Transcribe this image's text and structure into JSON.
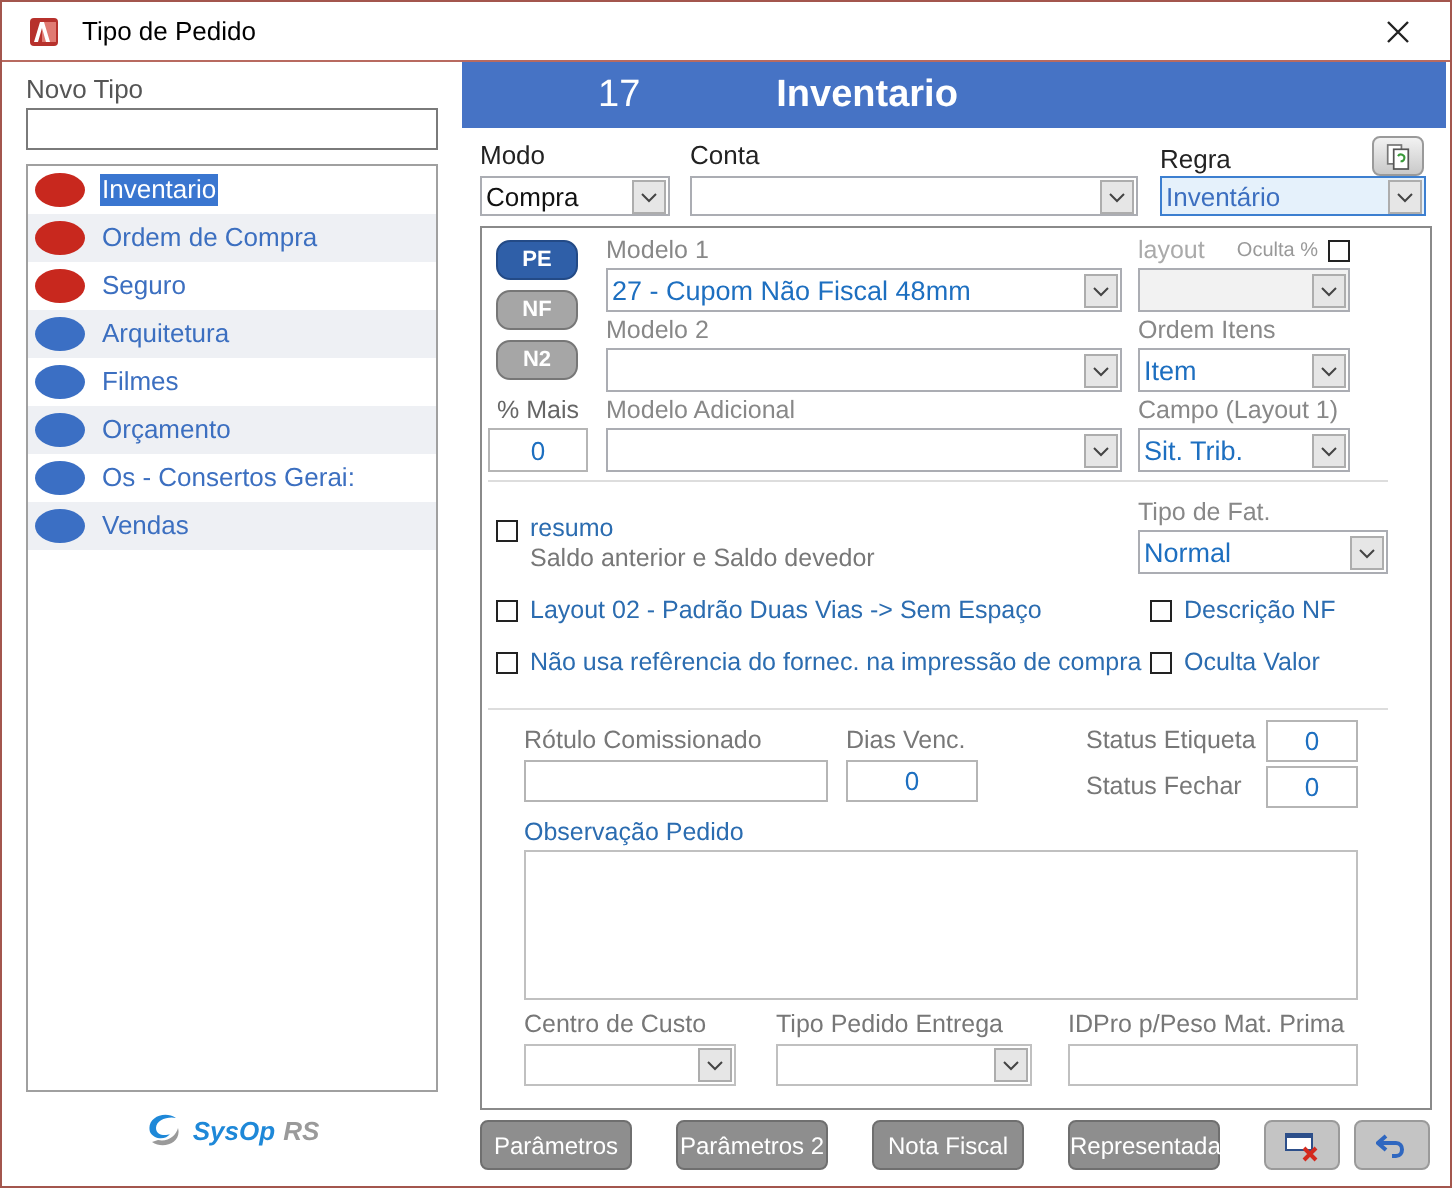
{
  "window": {
    "title": "Tipo de Pedido"
  },
  "new_type": {
    "label": "Novo Tipo"
  },
  "type_list": {
    "items": [
      {
        "name": "Inventario",
        "color": "#c8281e",
        "selected": true
      },
      {
        "name": "Ordem de Compra",
        "color": "#c8281e",
        "selected": false
      },
      {
        "name": "Seguro",
        "color": "#c8281e",
        "selected": false
      },
      {
        "name": "Arquitetura",
        "color": "#3b6fc4",
        "selected": false
      },
      {
        "name": "Filmes",
        "color": "#3b6fc4",
        "selected": false
      },
      {
        "name": "Orçamento",
        "color": "#3b6fc4",
        "selected": false
      },
      {
        "name": "Os - Consertos Gerai:",
        "color": "#3b6fc4",
        "selected": false
      },
      {
        "name": "Vendas",
        "color": "#3b6fc4",
        "selected": false
      }
    ]
  },
  "logo": {
    "name": "SysOp",
    "suffix": "RS"
  },
  "header": {
    "number": "17",
    "name": "Inventario"
  },
  "modo": {
    "label": "Modo",
    "value": "Compra"
  },
  "conta": {
    "label": "Conta"
  },
  "regra": {
    "label": "Regra",
    "value": "Inventário",
    "focused": true
  },
  "print_buttons": [
    {
      "label": "PE",
      "selected": true
    },
    {
      "label": "NF",
      "selected": false
    },
    {
      "label": "N2",
      "selected": false
    }
  ],
  "percent_more": {
    "label": "% Mais",
    "value": "0"
  },
  "modelo_1": {
    "label": "Modelo 1",
    "value": "27 - Cupom Não Fiscal 48mm"
  },
  "modelo_2": {
    "label": "Modelo 2"
  },
  "modelo_adicional": {
    "label": "Modelo Adicional"
  },
  "layout": {
    "label": "layout",
    "disabled": true
  },
  "oculta_percent": {
    "label": "Oculta %",
    "checked": false
  },
  "ordem_itens": {
    "label": "Ordem Itens",
    "value": "Item"
  },
  "campo_layout_1": {
    "label": "Campo (Layout 1)",
    "value": "Sit. Trib."
  },
  "tipo_fat": {
    "label": "Tipo de Fat.",
    "value": "Normal"
  },
  "options": [
    {
      "label": "resumo",
      "note": "Saldo anterior e Saldo devedor",
      "checked": false
    },
    {
      "label": "Layout 02 - Padrão Duas Vias -> Sem Espaço",
      "checked": false
    },
    {
      "label": "Não usa refêrencia do fornec. na impressão de compra",
      "checked": false
    }
  ],
  "options_right": [
    {
      "label": "Descrição NF",
      "checked": false
    },
    {
      "label": "Oculta Valor",
      "checked": false
    }
  ],
  "rotulo_comissionado": {
    "label": "Rótulo Comissionado"
  },
  "dias_venc": {
    "label": "Dias Venc.",
    "value": "0"
  },
  "status_etiqueta": {
    "label": "Status Etiqueta",
    "value": "0"
  },
  "status_fechar": {
    "label": "Status Fechar",
    "value": "0"
  },
  "observacao": {
    "label": "Observação Pedido"
  },
  "centro_custo": {
    "label": "Centro de Custo"
  },
  "tipo_pedido_entrega": {
    "label": "Tipo Pedido Entrega"
  },
  "idpro": {
    "label": "IDPro p/Peso Mat. Prima"
  },
  "footer_buttons": [
    {
      "label": "Parâmetros"
    },
    {
      "label": "Parâmetros 2"
    },
    {
      "label": "Nota Fiscal"
    },
    {
      "label": "Representada"
    }
  ]
}
